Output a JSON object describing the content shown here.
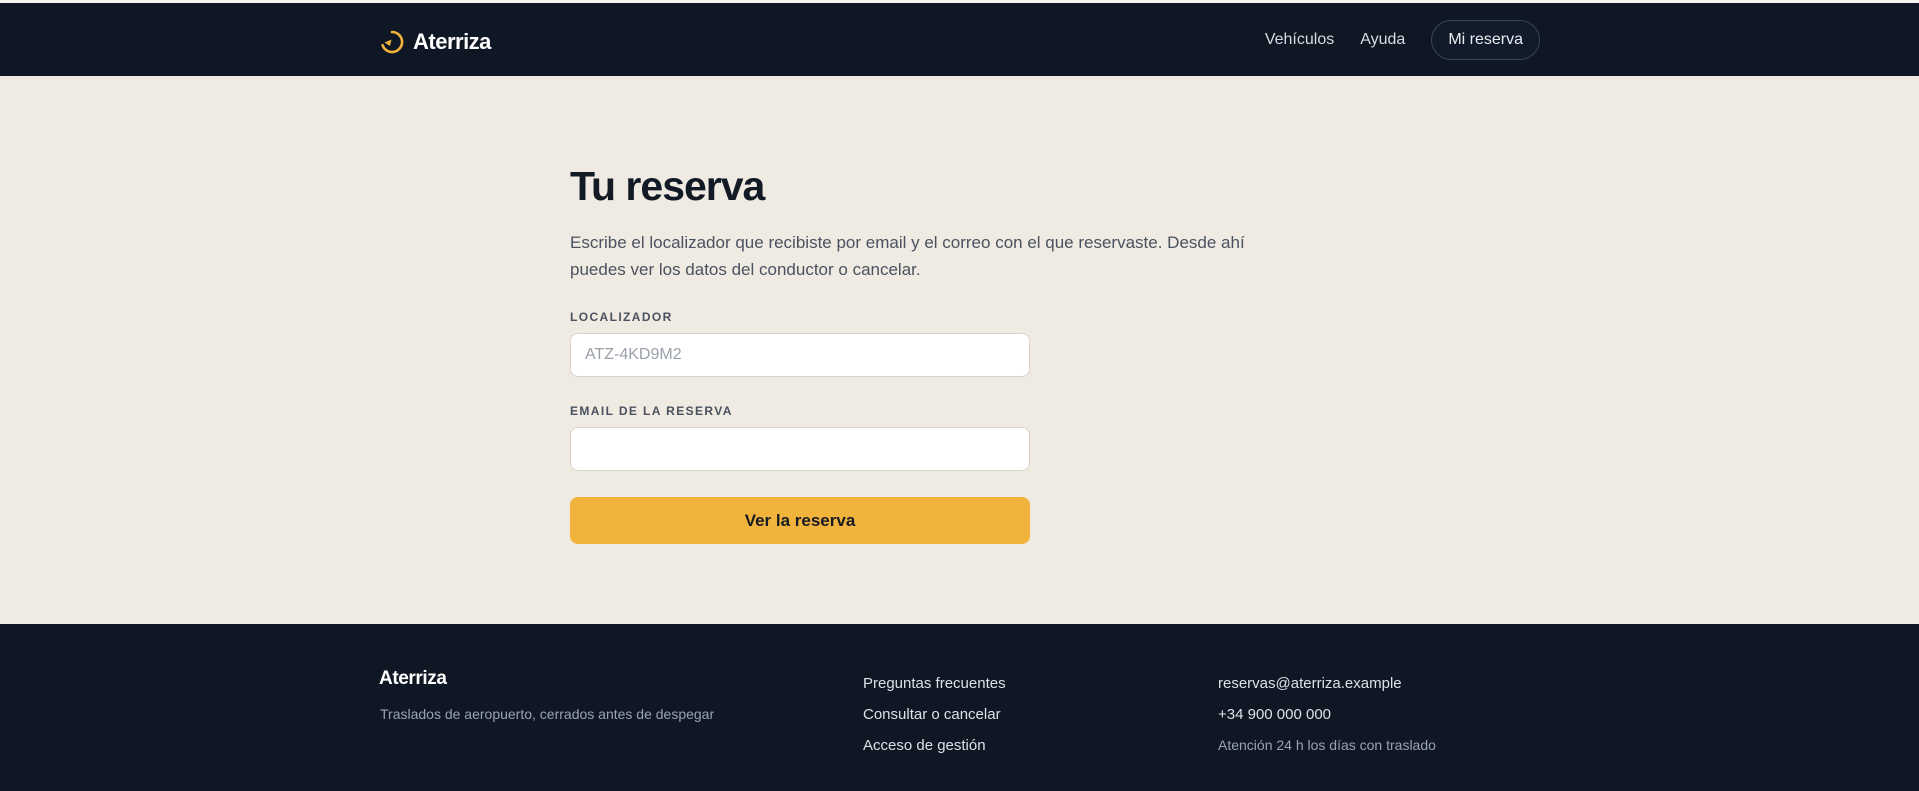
{
  "header": {
    "brand": "Aterriza",
    "nav": {
      "vehicles": "Vehículos",
      "help": "Ayuda",
      "my_booking": "Mi reserva"
    }
  },
  "main": {
    "title": "Tu reserva",
    "lead": "Escribe el localizador que recibiste por email y el correo con el que reservaste. Desde ahí puedes ver los datos del conductor o cancelar.",
    "locator_label": "LOCALIZADOR",
    "locator_placeholder": "ATZ-4KD9M2",
    "locator_value": "",
    "email_label": "EMAIL DE LA RESERVA",
    "email_placeholder": "",
    "email_value": "",
    "submit_label": "Ver la reserva"
  },
  "footer": {
    "brand": "Aterriza",
    "tagline": "Traslados de aeropuerto, cerrados antes de despegar",
    "links": [
      "Preguntas frecuentes",
      "Consultar o cancelar",
      "Acceso de gestión"
    ],
    "email": "reservas@aterriza.example",
    "phone": "+34 900 000 000",
    "hours": "Atención 24 h los días con traslado"
  },
  "colors": {
    "dark": "#0f1724",
    "cream": "#f0ebe2",
    "accent": "#f2b33d"
  },
  "icons": {
    "logo": "brand-logo-icon"
  }
}
